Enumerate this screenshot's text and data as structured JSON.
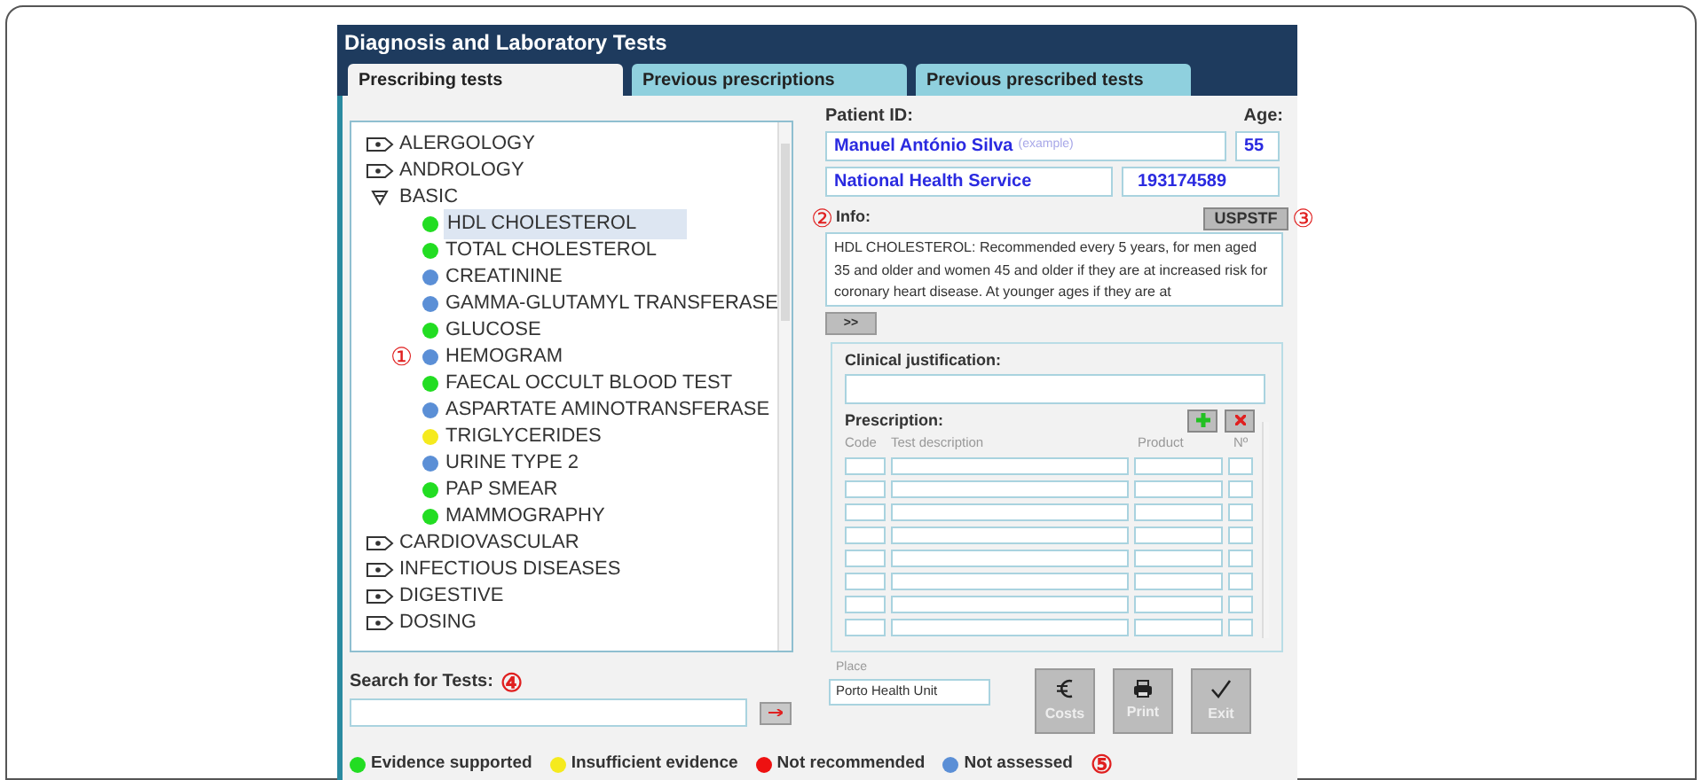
{
  "window": {
    "title": "Diagnosis and Laboratory Tests"
  },
  "tabs": [
    {
      "label": "Prescribing tests",
      "selected": true
    },
    {
      "label": "Previous prescriptions",
      "selected": false
    },
    {
      "label": "Previous prescribed tests",
      "selected": false
    }
  ],
  "tree": [
    {
      "label": "ALERGOLOGY",
      "expanded": false
    },
    {
      "label": "ANDROLOGY",
      "expanded": false
    },
    {
      "label": "BASIC",
      "expanded": true,
      "children": [
        {
          "label": "HDL CHOLESTEROL",
          "color": "#22dd22",
          "selected": true
        },
        {
          "label": "TOTAL CHOLESTEROL",
          "color": "#22dd22",
          "selected": false
        },
        {
          "label": "CREATININE",
          "color": "#5b8fd6",
          "selected": false
        },
        {
          "label": "GAMMA-GLUTAMYL TRANSFERASE",
          "color": "#5b8fd6",
          "selected": false
        },
        {
          "label": "GLUCOSE",
          "color": "#22dd22",
          "selected": false
        },
        {
          "label": "HEMOGRAM",
          "color": "#5b8fd6",
          "selected": false,
          "annotation": "①"
        },
        {
          "label": "FAECAL OCCULT BLOOD TEST",
          "color": "#22dd22",
          "selected": false
        },
        {
          "label": "ASPARTATE AMINOTRANSFERASE",
          "color": "#5b8fd6",
          "selected": false
        },
        {
          "label": "TRIGLYCERIDES",
          "color": "#f5ea1e",
          "selected": false
        },
        {
          "label": "URINE TYPE 2",
          "color": "#5b8fd6",
          "selected": false
        },
        {
          "label": "PAP SMEAR",
          "color": "#22dd22",
          "selected": false
        },
        {
          "label": "MAMMOGRAPHY",
          "color": "#22dd22",
          "selected": false
        }
      ]
    },
    {
      "label": "CARDIOVASCULAR",
      "expanded": false
    },
    {
      "label": "INFECTIOUS DISEASES",
      "expanded": false
    },
    {
      "label": "DIGESTIVE",
      "expanded": false
    },
    {
      "label": "DOSING",
      "expanded": false
    }
  ],
  "search": {
    "label": "Search for Tests:",
    "annotation": "④"
  },
  "legend": [
    {
      "label": "Evidence supported",
      "color": "#22dd22"
    },
    {
      "label": "Insufficient evidence",
      "color": "#f5ea1e"
    },
    {
      "label": "Not recommended",
      "color": "#ee1111"
    },
    {
      "label": "Not assessed",
      "color": "#5b8fd6"
    }
  ],
  "legend_annotation": "⑤",
  "patient": {
    "id_label": "Patient ID:",
    "name": "Manuel António Silva",
    "name_hint": "(example)",
    "age_label": "Age:",
    "age": "55",
    "insurer": "National Health Service",
    "number": "193174589"
  },
  "uspstf": {
    "label": "USPSTF",
    "annotation": "③"
  },
  "info": {
    "label": "Info:",
    "annotation": "②",
    "text": "HDL CHOLESTEROL: Recommended every 5 years, for men aged 35 and older and women 45 and older if they are at increased risk for coronary heart disease. At younger ages if they are at"
  },
  "more_button": ">>",
  "clinical": {
    "label": "Clinical justification:"
  },
  "prescription": {
    "label": "Prescription:",
    "columns": [
      "Code",
      "Test description",
      "Product",
      "Nº"
    ],
    "rows": [
      {
        "kind": "blank"
      },
      {
        "kind": "blank"
      },
      {
        "kind": "blank"
      },
      {
        "kind": "blank"
      },
      {
        "kind": "blank"
      },
      {
        "kind": "blank"
      },
      {
        "kind": "blank"
      },
      {
        "kind": "blank"
      }
    ]
  },
  "place": {
    "label": "Place",
    "value": "Porto Health Unit"
  },
  "actions": [
    {
      "label": "Costs",
      "kind": "costs"
    },
    {
      "label": "Print",
      "kind": "print"
    },
    {
      "label": "Exit",
      "kind": "exit"
    }
  ]
}
